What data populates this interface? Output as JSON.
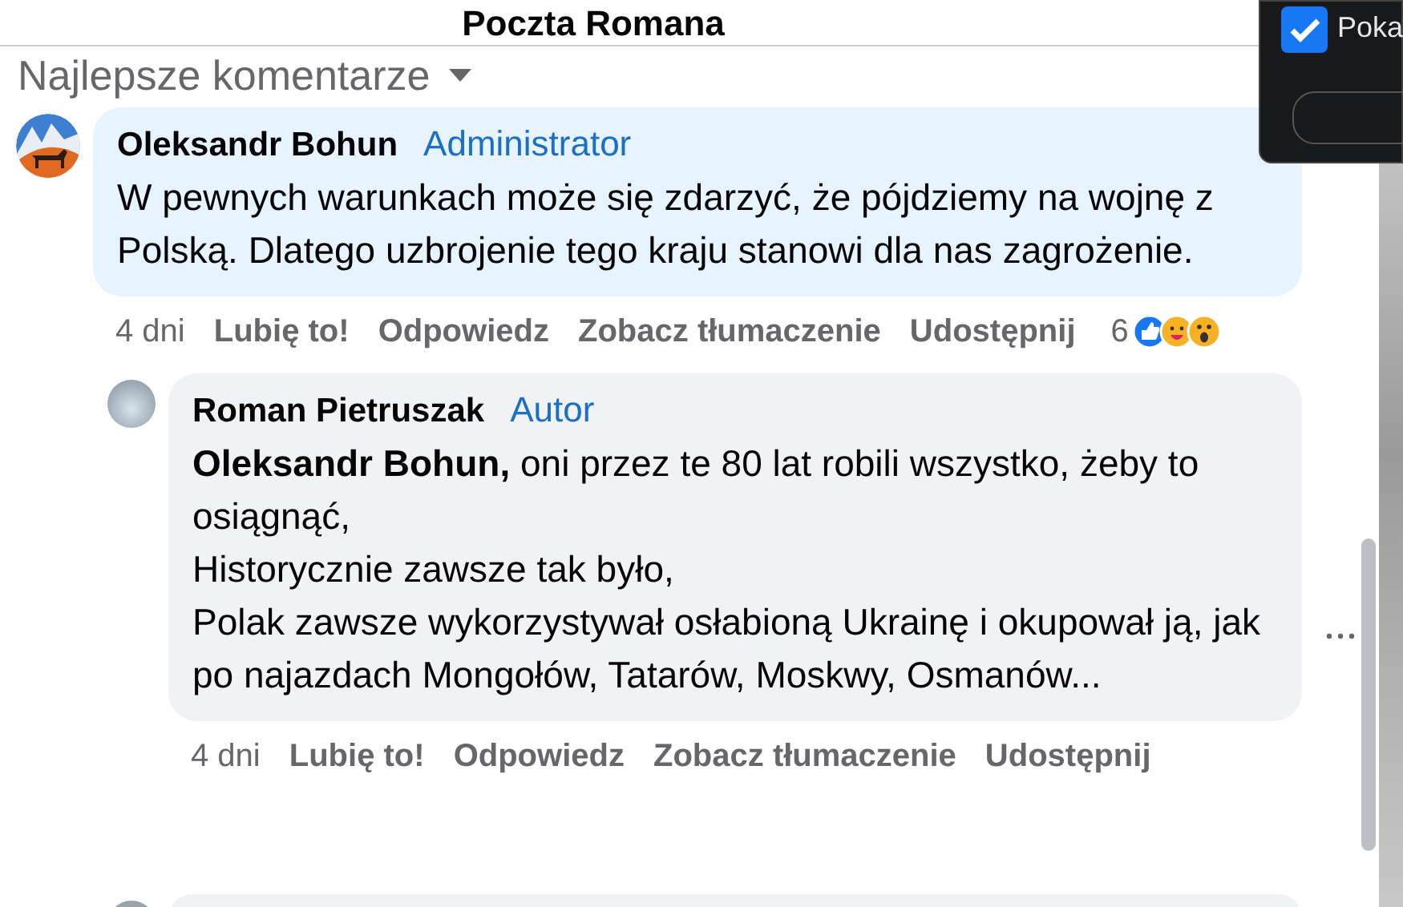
{
  "header": {
    "title": "Poczta Romana"
  },
  "sort": {
    "label": "Najlepsze komentarze"
  },
  "comments": [
    {
      "author": "Oleksandr Bohun",
      "badge": "Administrator",
      "lines": [
        "W pewnych warunkach może się zdarzyć, że pójdziemy na wojnę z Polską. Dlatego uzbrojenie tego kraju stanowi dla nas zagrożenie."
      ],
      "time": "4 dni",
      "actions": [
        "Lubię to!",
        "Odpowiedz",
        "Zobacz tłumaczenie",
        "Udostępnij"
      ],
      "reaction_count": "6",
      "reactions": [
        {
          "kind": "like"
        },
        {
          "kind": "care"
        },
        {
          "kind": "wow"
        }
      ],
      "replies": [
        {
          "author": "Roman Pietruszak",
          "badge": "Autor",
          "lines": [
            "**Oleksandr Bohun,** oni przez te 80 lat robili wszystko, żeby to osiągnąć,",
            "Historycznie zawsze tak było,",
            "Polak zawsze wykorzystywał osłabioną Ukrainę i okupował ją, jak po najazdach Mongołów, Tatarów, Moskwy, Osmanów..."
          ],
          "time": "4 dni",
          "actions": [
            "Lubię to!",
            "Odpowiedz",
            "Zobacz tłumaczenie",
            "Udostępnij"
          ]
        }
      ]
    }
  ],
  "popup": {
    "checkbox_label": "Poka",
    "checked": true
  }
}
